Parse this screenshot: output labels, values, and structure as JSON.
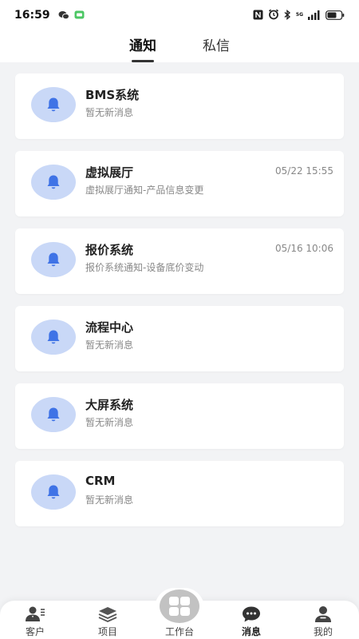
{
  "status_bar": {
    "time": "16:59",
    "network": "5G"
  },
  "tabs": [
    {
      "label": "通知",
      "active": true
    },
    {
      "label": "私信",
      "active": false
    }
  ],
  "notifications": [
    {
      "title": "BMS系统",
      "subtitle": "暂无新消息",
      "time": ""
    },
    {
      "title": "虚拟展厅",
      "subtitle": "虚拟展厅通知-产品信息变更",
      "time": "05/22 15:55"
    },
    {
      "title": "报价系统",
      "subtitle": "报价系统通知-设备底价变动",
      "time": "05/16 10:06"
    },
    {
      "title": "流程中心",
      "subtitle": "暂无新消息",
      "time": ""
    },
    {
      "title": "大屏系统",
      "subtitle": "暂无新消息",
      "time": ""
    },
    {
      "title": "CRM",
      "subtitle": "暂无新消息",
      "time": ""
    }
  ],
  "bottom_nav": {
    "items": [
      {
        "label": "客户",
        "icon": "customer-icon"
      },
      {
        "label": "项目",
        "icon": "layers-icon"
      },
      {
        "label": "工作台",
        "icon": "grid-icon"
      },
      {
        "label": "消息",
        "icon": "chat-icon",
        "active": true
      },
      {
        "label": "我的",
        "icon": "profile-icon"
      }
    ]
  },
  "colors": {
    "page_bg": "#f2f3f5",
    "avatar_bg": "#c9d8f7",
    "bell": "#3f73e6",
    "muted_text": "#888888"
  }
}
